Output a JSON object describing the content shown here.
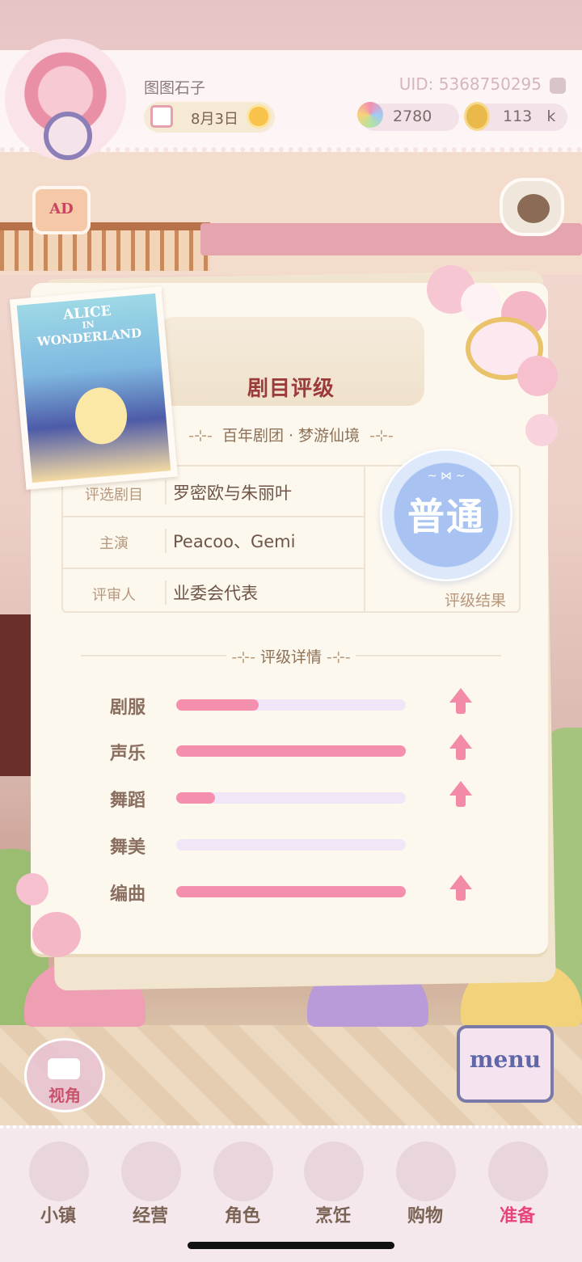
{
  "header": {
    "username": "图图石子",
    "uid": "UID: 5368750295",
    "date": "8月3日",
    "gems": "2780",
    "coins": "113",
    "coins_unit": "k"
  },
  "side_buttons": {
    "ad_label": "AD"
  },
  "poster": {
    "title_line1": "ALICE",
    "title_line2": "IN",
    "title_line3": "WONDERLAND"
  },
  "panel": {
    "title": "剧目评级",
    "subtitle": "百年剧团 · 梦游仙境",
    "info": [
      {
        "label": "评选剧目",
        "value": "罗密欧与朱丽叶"
      },
      {
        "label": "主演",
        "value": "Peacoo、Gemi"
      },
      {
        "label": "评审人",
        "value": "业委会代表"
      }
    ],
    "result": {
      "value": "普通",
      "label": "评级结果"
    },
    "details_title": "评级详情",
    "stats": [
      {
        "label": "剧服",
        "level": 0.36,
        "arrow": true
      },
      {
        "label": "声乐",
        "level": 1.0,
        "arrow": true
      },
      {
        "label": "舞蹈",
        "level": 0.17,
        "arrow": true
      },
      {
        "label": "舞美",
        "level": 0.0,
        "arrow": false
      },
      {
        "label": "编曲",
        "level": 1.0,
        "arrow": true
      }
    ]
  },
  "controls": {
    "view_label": "视角",
    "menu_label": "menu"
  },
  "nav": [
    {
      "label": "小镇",
      "icon": "map-icon",
      "active": false
    },
    {
      "label": "经营",
      "icon": "lock-bag-icon",
      "active": false
    },
    {
      "label": "角色",
      "icon": "character-icon",
      "active": false
    },
    {
      "label": "烹饪",
      "icon": "cake-icon",
      "active": false
    },
    {
      "label": "购物",
      "icon": "shopping-bag-icon",
      "active": false
    },
    {
      "label": "准备",
      "icon": "picnic-basket-icon",
      "active": true
    }
  ],
  "colors": {
    "bar_fill": "#f58fae",
    "bar_track": "#f1e6f8",
    "active_nav": "#e9447a",
    "badge_blue": "#a8c3f2"
  }
}
